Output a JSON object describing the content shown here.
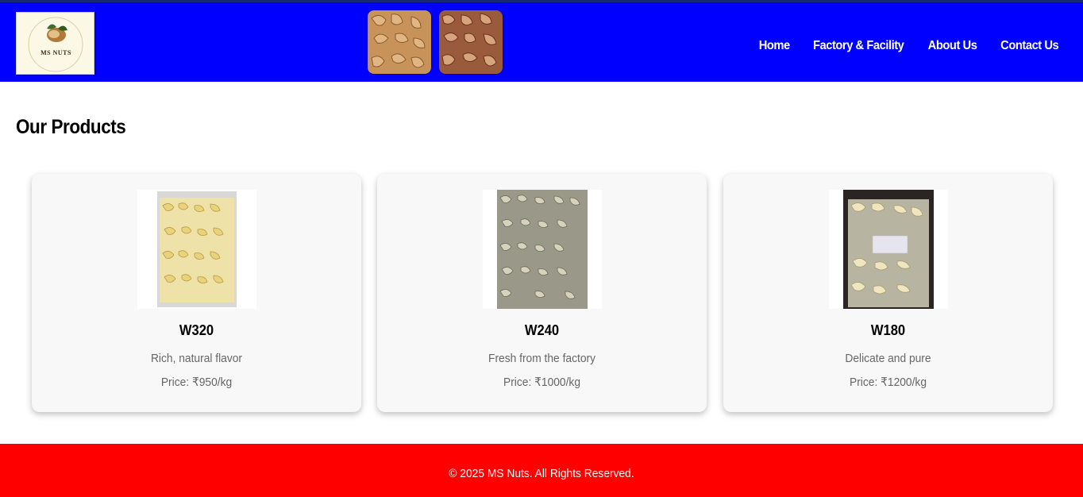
{
  "brand": {
    "logo_text": "MS NUTS"
  },
  "nav": {
    "items": [
      {
        "label": "Home"
      },
      {
        "label": "Factory & Facility"
      },
      {
        "label": "About Us"
      },
      {
        "label": "Contact Us"
      }
    ]
  },
  "main": {
    "title": "Our Products",
    "products": [
      {
        "name": "W320",
        "description": "Rich, natural flavor",
        "price": "Price: ₹950/kg"
      },
      {
        "name": "W240",
        "description": "Fresh from the factory",
        "price": "Price: ₹1000/kg"
      },
      {
        "name": "W180",
        "description": "Delicate and pure",
        "price": "Price: ₹1200/kg"
      }
    ]
  },
  "footer": {
    "text": "© 2025 MS Nuts. All Rights Reserved."
  },
  "colors": {
    "header": "#0000ff",
    "footer": "#ff0000",
    "card": "#f8f8f8"
  }
}
